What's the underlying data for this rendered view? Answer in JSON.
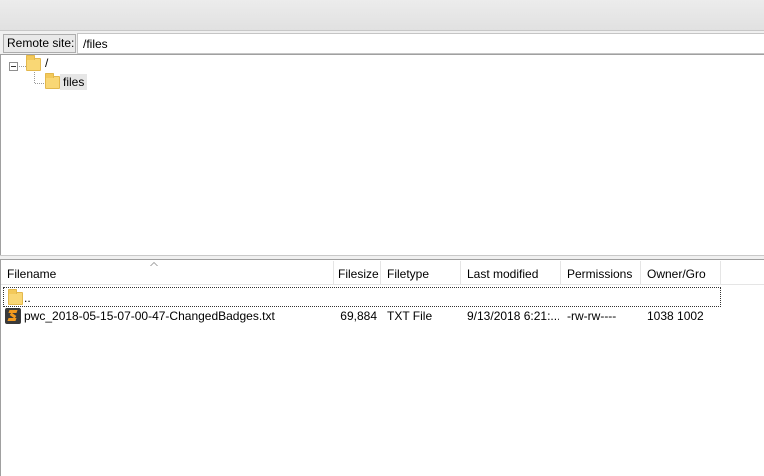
{
  "remote_site": {
    "label": "Remote site:",
    "path": "/files"
  },
  "tree": {
    "root_label": "/",
    "child_label": "files"
  },
  "file_list": {
    "columns": [
      "Filename",
      "Filesize",
      "Filetype",
      "Last modified",
      "Permissions",
      "Owner/Gro"
    ],
    "rows": [
      {
        "filename": "..",
        "filesize": "",
        "filetype": "",
        "last_modified": "",
        "permissions": "",
        "owner": "",
        "icon": "folder-icon"
      },
      {
        "filename": "pwc_2018-05-15-07-00-47-ChangedBadges.txt",
        "filesize": "69,884",
        "filetype": "TXT File",
        "last_modified": "9/13/2018 6:21:...",
        "permissions": "-rw-rw----",
        "owner": "1038 1002",
        "icon": "text-file-icon"
      }
    ]
  },
  "colors": {
    "folder": "#f9d775",
    "text_file_icon_bg": "#3a3a3a",
    "text_file_icon_accent": "#f39a1d"
  }
}
